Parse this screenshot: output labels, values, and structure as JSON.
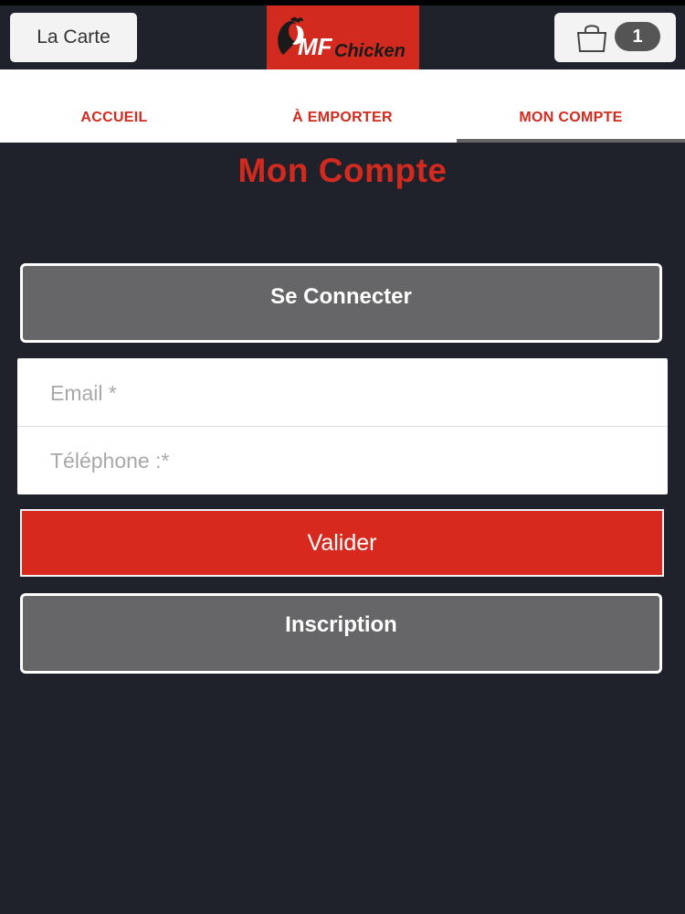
{
  "header": {
    "menu_label": "La Carte",
    "logo_text_primary": "MF",
    "logo_text_secondary": "Chicken",
    "cart_count": "1",
    "brand_color": "#d32a1f",
    "cart_icon": "shopping-bag-icon"
  },
  "nav": {
    "tabs": [
      {
        "label": "ACCUEIL"
      },
      {
        "label": "À EMPORTER"
      },
      {
        "label": "MON COMPTE",
        "active": true
      }
    ]
  },
  "page": {
    "title": "Mon Compte"
  },
  "login": {
    "connect_label": "Se Connecter",
    "email_placeholder": "Email *",
    "phone_placeholder": "Téléphone :*",
    "submit_label": "Valider",
    "signup_label": "Inscription"
  }
}
